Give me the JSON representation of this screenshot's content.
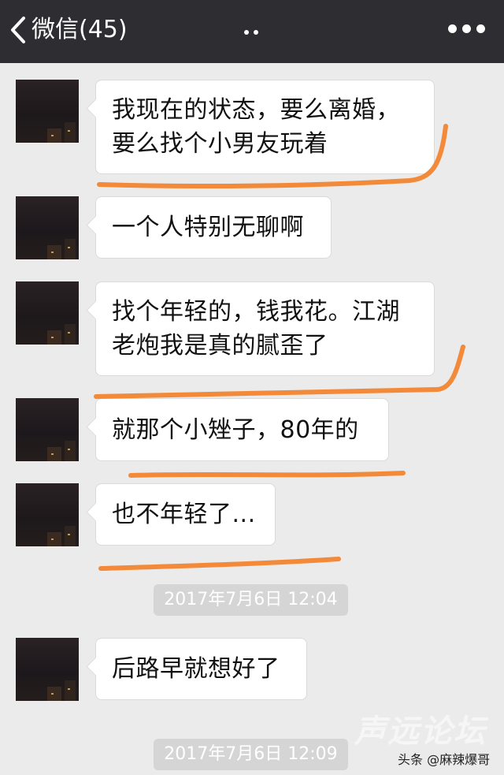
{
  "header": {
    "back_label": "微信(45)",
    "title_hidden_indicator": "..",
    "more_icon": "more-dots-icon"
  },
  "messages": [
    {
      "type": "incoming",
      "text": "我现在的状态，要么离婚，\n要么找个小男友玩着"
    },
    {
      "type": "incoming",
      "text": "一个人特别无聊啊"
    },
    {
      "type": "incoming",
      "text": "找个年轻的，钱我花。江湖\n老炮我是真的腻歪了"
    },
    {
      "type": "incoming",
      "text": "就那个小矬子，80年的"
    },
    {
      "type": "incoming",
      "text": "也不年轻了..."
    },
    {
      "type": "timestamp",
      "text": "2017年7月6日 12:04"
    },
    {
      "type": "incoming",
      "text": "后路早就想好了"
    },
    {
      "type": "timestamp",
      "text": "2017年7月6日 12:09"
    }
  ],
  "annotation_color": "#f28a3a",
  "watermarks": {
    "forum": "声远论坛",
    "source": "头条 @麻辣爆哥"
  },
  "colors": {
    "header_bg": "#2e2e32",
    "chat_bg": "#ebebeb",
    "bubble_bg": "#ffffff",
    "timestamp_bg": "#d5d5d5"
  }
}
